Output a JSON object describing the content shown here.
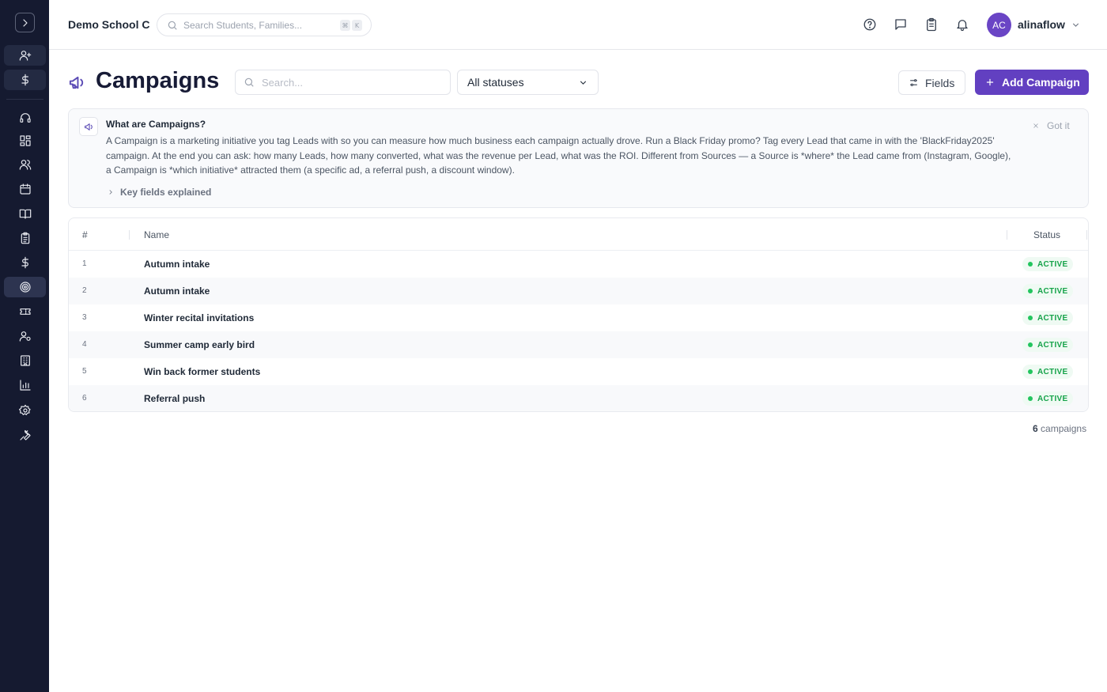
{
  "app": {
    "school_name": "Demo School C",
    "search_placeholder": "Search Students, Families...",
    "kbd_keys": [
      "⌘",
      "K"
    ],
    "user": {
      "initials": "AC",
      "name": "alinaflow"
    }
  },
  "sidebar": {
    "items": [
      {
        "icon": "user-plus-icon"
      },
      {
        "icon": "dollar-icon"
      },
      {
        "icon": "headset-icon"
      },
      {
        "icon": "dashboard-icon"
      },
      {
        "icon": "users-icon"
      },
      {
        "icon": "calendar-icon"
      },
      {
        "icon": "book-icon"
      },
      {
        "icon": "clipboard-icon"
      },
      {
        "icon": "dollar-icon"
      },
      {
        "icon": "target-icon",
        "active": true
      },
      {
        "icon": "ticket-icon"
      },
      {
        "icon": "user-settings-icon"
      },
      {
        "icon": "building-icon"
      },
      {
        "icon": "bar-chart-icon"
      },
      {
        "icon": "gear-icon"
      },
      {
        "icon": "wrench-icon"
      }
    ]
  },
  "page": {
    "title": "Campaigns",
    "search_placeholder": "Search...",
    "status_filter": "All statuses",
    "fields_label": "Fields",
    "add_label": "Add Campaign"
  },
  "info": {
    "title": "What are Campaigns?",
    "body": "A Campaign is a marketing initiative you tag Leads with so you can measure how much business each campaign actually drove. Run a Black Friday promo? Tag every Lead that came in with the 'BlackFriday2025' campaign. At the end you can ask: how many Leads, how many converted, what was the revenue per Lead, what was the ROI. Different from Sources — a Source is *where* the Lead came from (Instagram, Google), a Campaign is *which initiative* attracted them (a specific ad, a referral push, a discount window).",
    "dismiss_label": "Got it",
    "key_fields_label": "Key fields explained"
  },
  "table": {
    "columns": [
      "#",
      "Name",
      "Status"
    ],
    "rows": [
      {
        "num": "1",
        "name": "Autumn intake",
        "status": "ACTIVE"
      },
      {
        "num": "2",
        "name": "Autumn intake",
        "status": "ACTIVE"
      },
      {
        "num": "3",
        "name": "Winter recital invitations",
        "status": "ACTIVE"
      },
      {
        "num": "4",
        "name": "Summer camp early bird",
        "status": "ACTIVE"
      },
      {
        "num": "5",
        "name": "Win back former students",
        "status": "ACTIVE"
      },
      {
        "num": "6",
        "name": "Referral push",
        "status": "ACTIVE"
      }
    ],
    "count_num": "6",
    "count_label": "campaigns"
  },
  "colors": {
    "sidebar_bg": "#151a30",
    "accent": "#6240c1",
    "active_green": "#16a34a"
  }
}
